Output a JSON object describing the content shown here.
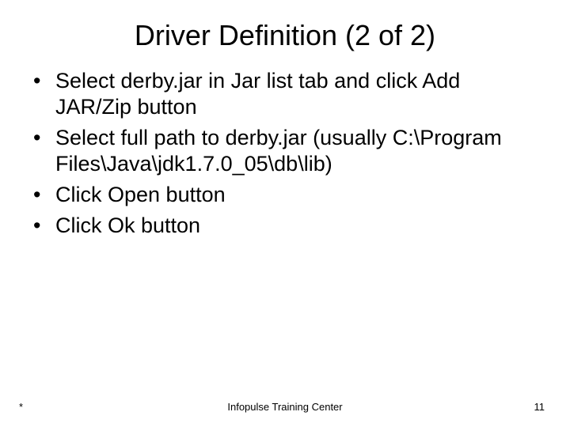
{
  "title": "Driver Definition (2 of 2)",
  "bullets": [
    "Select derby.jar in Jar list tab and click Add JAR/Zip button",
    "Select full path to derby.jar (usually C:\\Program Files\\Java\\jdk1.7.0_05\\db\\lib)",
    "Click Open button",
    "Click Ok button"
  ],
  "footer": {
    "left": "*",
    "center": "Infopulse Training Center",
    "right": "11"
  }
}
